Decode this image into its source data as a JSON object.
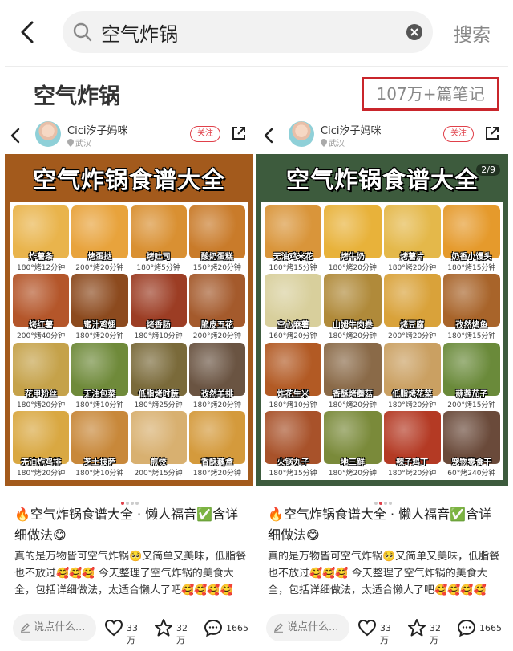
{
  "search": {
    "query": "空气炸锅",
    "button_label": "搜索"
  },
  "header": {
    "title": "空气炸锅",
    "note_count": "107万+篇笔记"
  },
  "cards": [
    {
      "author": "Cici汐子妈咪",
      "location": "武汉",
      "follow_label": "关注",
      "poster_title": "空气炸锅食谱大全",
      "page_badge": "",
      "poster_color": "#a35a1c",
      "dots_active": 0,
      "foods": [
        {
          "name": "炸薯条",
          "spec": "180°烤12分钟",
          "color": "#e9b44c"
        },
        {
          "name": "烤蛋挞",
          "spec": "200°烤20分钟",
          "color": "#e8a33c"
        },
        {
          "name": "烤吐司",
          "spec": "180°烤5分钟",
          "color": "#d99032"
        },
        {
          "name": "酸奶蛋糕",
          "spec": "150°烤20分钟",
          "color": "#c97b2a"
        },
        {
          "name": "烤红薯",
          "spec": "200°烤40分钟",
          "color": "#b4562a"
        },
        {
          "name": "蜜汁鸡翅",
          "spec": "180°烤20分钟",
          "color": "#8c4a1e"
        },
        {
          "name": "烤香肠",
          "spec": "180°烤10分钟",
          "color": "#9c3d24"
        },
        {
          "name": "脆皮五花",
          "spec": "200°烤20分钟",
          "color": "#a45a2c"
        },
        {
          "name": "花甲粉丝",
          "spec": "180°烤20分钟",
          "color": "#c5a24a"
        },
        {
          "name": "无油包菜",
          "spec": "180°烤10分钟",
          "color": "#6f8a3a"
        },
        {
          "name": "低脂烤时蔬",
          "spec": "180°烤25分钟",
          "color": "#7a6a3a"
        },
        {
          "name": "孜然羊排",
          "spec": "180°烤20分钟",
          "color": "#6a5442"
        },
        {
          "name": "无油炸鸡排",
          "spec": "180°烤20分钟",
          "color": "#d9a842"
        },
        {
          "name": "芝士披萨",
          "spec": "180°烤10分钟",
          "color": "#c8883a"
        },
        {
          "name": "煎饺",
          "spec": "200°烤15分钟",
          "color": "#d8b070"
        },
        {
          "name": "香酥藕盒",
          "spec": "180°烤20分钟",
          "color": "#d49a3c"
        }
      ],
      "note_title": "🔥空气炸锅食谱大全 · 懒人福音✅含详细做法😋",
      "note_body": "真的是万物皆可空气炸锅🥺又简单又美味，低脂餐也不放过🥰🥰🥰 今天整理了空气炸锅的美食大全，包括详细做法，太适合懒人了吧🥰🥰🥰🥰",
      "comment_placeholder": "说点什么...",
      "likes": "33万",
      "favorites": "32万",
      "comments": "1665"
    },
    {
      "author": "Cici汐子妈咪",
      "location": "武汉",
      "follow_label": "关注",
      "poster_title": "空气炸锅食谱大全",
      "page_badge": "2/9",
      "poster_color": "#3d5b3d",
      "dots_active": 1,
      "foods": [
        {
          "name": "无油鸡米花",
          "spec": "180°烤15分钟",
          "color": "#d9953a"
        },
        {
          "name": "烤牛奶",
          "spec": "180°烤20分钟",
          "color": "#e8b23a"
        },
        {
          "name": "烤薯片",
          "spec": "180°烤20分钟",
          "color": "#e4b84a"
        },
        {
          "name": "奶香小馒头",
          "spec": "180°烤15分钟",
          "color": "#e59a2c"
        },
        {
          "name": "空心麻薯",
          "spec": "160°烤20分钟",
          "color": "#d8cf9c"
        },
        {
          "name": "山姆牛肉卷",
          "spec": "180°烤20分钟",
          "color": "#b08a3a"
        },
        {
          "name": "烤豆腐",
          "spec": "200°烤20分钟",
          "color": "#d9a23a"
        },
        {
          "name": "孜然烤鱼",
          "spec": "180°烤15分钟",
          "color": "#a8642a"
        },
        {
          "name": "炸花生米",
          "spec": "180°烤10分钟",
          "color": "#b25a24"
        },
        {
          "name": "香酥烤蘑菇",
          "spec": "180°烤20分钟",
          "color": "#8a6a48"
        },
        {
          "name": "低脂烤花菜",
          "spec": "180°烤20分钟",
          "color": "#caa062"
        },
        {
          "name": "蒜蓉茄子",
          "spec": "200°烤15分钟",
          "color": "#6a8a3a"
        },
        {
          "name": "火锅丸子",
          "spec": "180°烤15分钟",
          "color": "#a8522a"
        },
        {
          "name": "地三鲜",
          "spec": "180°烤20分钟",
          "color": "#7a8a3a"
        },
        {
          "name": "辣子鸡丁",
          "spec": "180°烤20分钟",
          "color": "#b43a24"
        },
        {
          "name": "宠物零食干",
          "spec": "60°烤240分钟",
          "color": "#6a4a3a"
        }
      ],
      "note_title": "🔥空气炸锅食谱大全 · 懒人福音✅含详细做法😋",
      "note_body": "真的是万物皆可空气炸锅🥺又简单又美味，低脂餐也不放过🥰🥰🥰 今天整理了空气炸锅的美食大全，包括详细做法，太适合懒人了吧🥰🥰🥰🥰",
      "comment_placeholder": "说点什么...",
      "likes": "33万",
      "favorites": "32万",
      "comments": "1665"
    }
  ],
  "colors": {
    "accent_red": "#c9252b",
    "follow_red": "#e0404a"
  },
  "icons": [
    "back-arrow-icon",
    "search-icon",
    "clear-icon",
    "share-icon",
    "location-pin-icon",
    "pen-icon",
    "heart-icon",
    "star-icon",
    "comment-bubble-icon"
  ]
}
